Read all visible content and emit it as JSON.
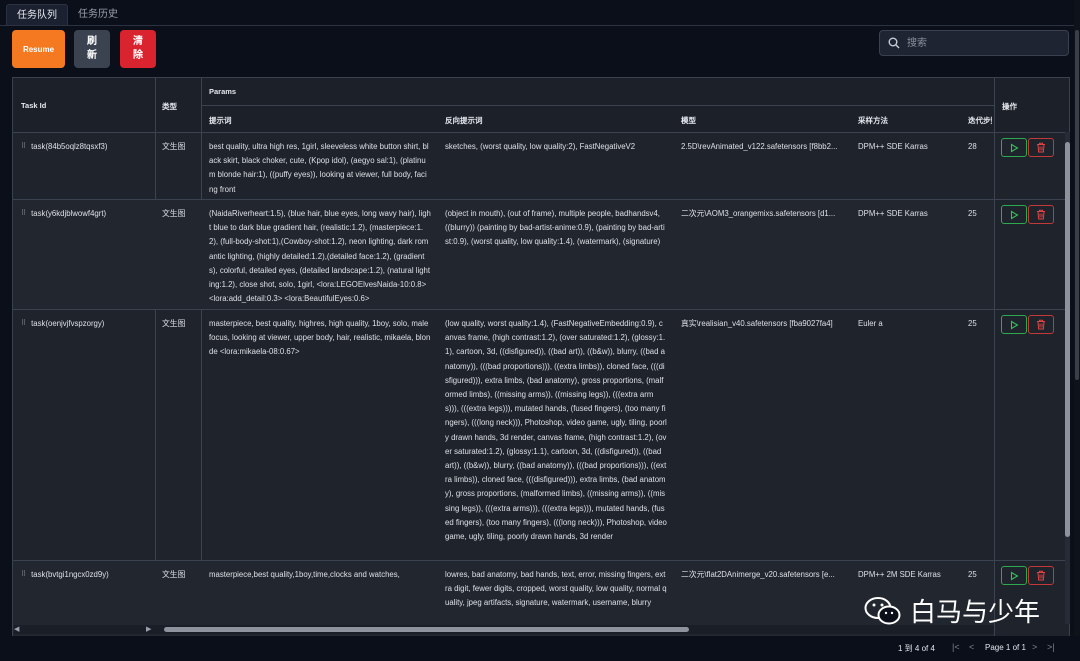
{
  "tabs": [
    "任务队列",
    "任务历史"
  ],
  "toolbar": {
    "resume": "Resume",
    "refresh": "刷新",
    "clear": "清除"
  },
  "search": {
    "placeholder": "搜索"
  },
  "columns": {
    "task_id": "Task Id",
    "type": "类型",
    "params": "Params",
    "prompt": "提示词",
    "negative": "反向提示词",
    "model": "模型",
    "sampler": "采样方法",
    "steps": "迭代步数",
    "actions": "操作"
  },
  "rows": [
    {
      "task_id": "task(84b5oqlz8tqsxf3)",
      "type": "文生图",
      "prompt": "best quality, ultra high res, 1girl, sleeveless white button shirt, black skirt, black choker, cute, (Kpop idol), (aegyo sal:1), (platinum blonde hair:1), ((puffy eyes)), looking at viewer, full body, facing front",
      "negative": "sketches, (worst quality, low quality:2), FastNegativeV2",
      "model": "2.5D\\revAnimated_v122.safetensors [f8bb2...",
      "sampler": "DPM++ SDE Karras",
      "steps": "28"
    },
    {
      "task_id": "task(y6kdjblwowf4grt)",
      "type": "文生图",
      "prompt": "(NaidaRiverheart:1.5), (blue hair, blue eyes, long wavy hair), light blue to dark blue gradient hair, (realistic:1.2), (masterpiece:1.2), (full-body-shot:1),(Cowboy-shot:1.2), neon lighting, dark romantic lighting, (highly detailed:1.2),(detailed face:1.2), (gradients), colorful, detailed eyes, (detailed landscape:1.2), (natural lighting:1.2), close shot, solo, 1girl, <lora:LEGOElvesNaida-10:0.8> <lora:add_detail:0.3> <lora:BeautifulEyes:0.6>",
      "negative": "(object in mouth), (out of frame), multiple people, badhandsv4, ((blurry)) (painting by bad-artist-anime:0.9), (painting by bad-artist:0.9), (worst quality, low quality:1.4), (watermark), (signature)",
      "model": "二次元\\AOM3_orangemixs.safetensors [d1...",
      "sampler": "DPM++ SDE Karras",
      "steps": "25"
    },
    {
      "task_id": "task(oenjvjfvspzorgy)",
      "type": "文生图",
      "prompt": "masterpiece, best quality, highres, high quality, 1boy, solo, male focus, looking at viewer, upper body, hair, realistic, mikaela, blonde <lora:mikaela-08:0.67>",
      "negative": "(low quality, worst quality:1.4), (FastNegativeEmbedding:0.9), canvas frame, (high contrast:1.2), (over saturated:1.2), (glossy:1.1), cartoon, 3d, ((disfigured)), ((bad art)), ((b&w)), blurry, ((bad anatomy)), (((bad proportions))), ((extra limbs)), cloned face, (((disfigured))), extra limbs, (bad anatomy), gross proportions, (malformed limbs), ((missing arms)), ((missing legs)), (((extra arms))), (((extra legs))), mutated hands, (fused fingers), (too many fingers), (((long neck))), Photoshop, video game, ugly, tiling, poorly drawn hands, 3d render, canvas frame, (high contrast:1.2), (over saturated:1.2), (glossy:1.1), cartoon, 3d, ((disfigured)), ((bad art)), ((b&w)), blurry, ((bad anatomy)), (((bad proportions))), ((extra limbs)), cloned face, (((disfigured))), extra limbs, (bad anatomy), gross proportions, (malformed limbs), ((missing arms)), ((missing legs)), (((extra arms))), (((extra legs))), mutated hands, (fused fingers), (too many fingers), (((long neck))), Photoshop, video game, ugly, tiling, poorly drawn hands, 3d render",
      "model": "真实\\realisian_v40.safetensors [fba9027fa4]",
      "sampler": "Euler a",
      "steps": "25"
    },
    {
      "task_id": "task(bvtgi1ngcx0zd9y)",
      "type": "文生图",
      "prompt": "masterpiece,best quality,1boy,time,clocks and watches,",
      "negative": "lowres, bad anatomy, bad hands, text, error, missing fingers, extra digit, fewer digits, cropped, worst quality, low quality, normal quality, jpeg artifacts, signature, watermark, username, blurry",
      "model": "二次元\\flat2DAnimerge_v20.safetensors [e...",
      "sampler": "DPM++ 2M SDE Karras",
      "steps": "25"
    }
  ],
  "footer": {
    "range": "1 到 4 of 4",
    "page": "Page 1 of 1"
  },
  "watermark": {
    "text": "白马与少年"
  },
  "colors": {
    "resume": "#f47920",
    "refresh": "#3b4250",
    "clear": "#d9232e",
    "play": "#2fa84f",
    "delete": "#c43838",
    "background": "#0b0f19"
  }
}
